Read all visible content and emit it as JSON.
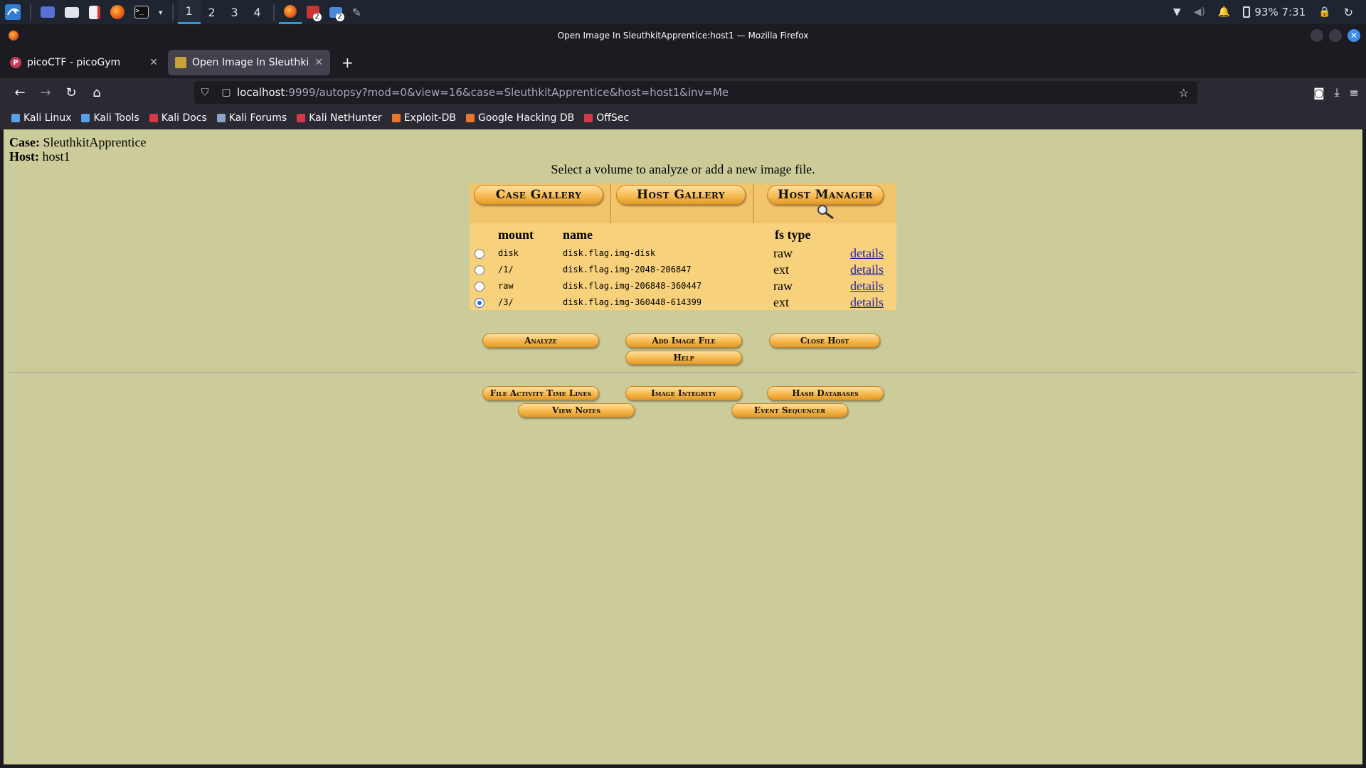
{
  "panel": {
    "workspaces": [
      "1",
      "2",
      "3",
      "4"
    ],
    "active_workspace": "1",
    "status": "93% 7:31",
    "badge_count": "2"
  },
  "window": {
    "title": "Open Image In SleuthkitApprentice:host1 — Mozilla Firefox"
  },
  "tabs": [
    {
      "label": "picoCTF - picoGym",
      "favicon": "picoctf-icon"
    },
    {
      "label": "Open Image In SleuthkitA",
      "favicon": "autopsy-icon"
    }
  ],
  "url": {
    "host": "localhost",
    "rest": ":9999/autopsy?mod=0&view=16&case=SleuthkitApprentice&host=host1&inv=Me"
  },
  "bookmarks": [
    {
      "label": "Kali Linux",
      "color": "#5aa0e6"
    },
    {
      "label": "Kali Tools",
      "color": "#5aa0e6"
    },
    {
      "label": "Kali Docs",
      "color": "#d6384a"
    },
    {
      "label": "Kali Forums",
      "color": "#8aa4c8"
    },
    {
      "label": "Kali NetHunter",
      "color": "#d6384a"
    },
    {
      "label": "Exploit-DB",
      "color": "#e8752a"
    },
    {
      "label": "Google Hacking DB",
      "color": "#e8752a"
    },
    {
      "label": "OffSec",
      "color": "#d6384a"
    }
  ],
  "page": {
    "case_label": "Case:",
    "case_value": "SleuthkitApprentice",
    "host_label": "Host:",
    "host_value": "host1",
    "prompt": "Select a volume to analyze or add a new image file.",
    "gallery_tabs": [
      "Case Gallery",
      "Host Gallery",
      "Host Manager"
    ],
    "columns": {
      "mount": "mount",
      "name": "name",
      "fstype": "fs type"
    },
    "volumes": [
      {
        "mount": "disk",
        "name": "disk.flag.img-disk",
        "fstype": "raw",
        "link": "details",
        "selected": false
      },
      {
        "mount": "/1/",
        "name": "disk.flag.img-2048-206847",
        "fstype": "ext",
        "link": "details",
        "selected": false
      },
      {
        "mount": "raw",
        "name": "disk.flag.img-206848-360447",
        "fstype": "raw",
        "link": "details",
        "selected": false
      },
      {
        "mount": "/3/",
        "name": "disk.flag.img-360448-614399",
        "fstype": "ext",
        "link": "details",
        "selected": true
      }
    ],
    "actions": {
      "analyze": "Analyze",
      "add_image": "Add Image File",
      "close_host": "Close Host",
      "help": "Help"
    },
    "tools": {
      "timelines": "File Activity Time Lines",
      "integrity": "Image Integrity",
      "hashdb": "Hash Databases",
      "notes": "View Notes",
      "sequencer": "Event Sequencer"
    }
  }
}
